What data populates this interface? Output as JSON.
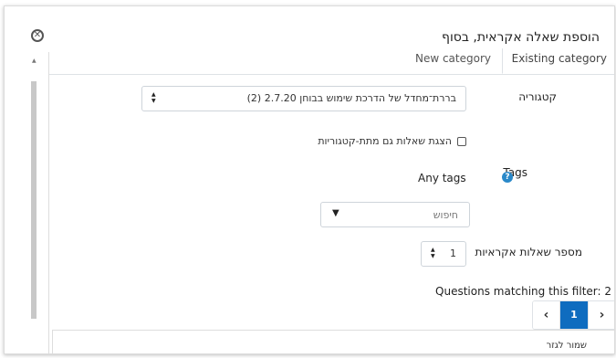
{
  "dialog": {
    "title": "הוספת שאלה אקראית, בסוף",
    "close_icon": "close-icon"
  },
  "tabs": [
    {
      "label": "Existing category",
      "active": true
    },
    {
      "label": "New category",
      "active": false
    }
  ],
  "form": {
    "category_label": "קטגוריה",
    "category_value": "בררת־מחדל של הדרכת שימוש בבוחן 2.7.20 (2)",
    "subcategories_label": "הצגת שאלות גם מתת-קטגוריות",
    "subcategories_checked": false,
    "tags_label": "Tags",
    "tags_value": "Any tags",
    "search_placeholder": "חיפוש",
    "random_count_label": "מספר שאלות אקראיות",
    "random_count_value": "1"
  },
  "matching": {
    "text": "Questions matching this filter: 2"
  },
  "pagination": {
    "prev": "‹",
    "current": "1",
    "next": "›"
  },
  "footer_cut_text": "שמור לגזר",
  "colors": {
    "accent": "#0f6cbf",
    "help_icon": "#2a89c9"
  }
}
